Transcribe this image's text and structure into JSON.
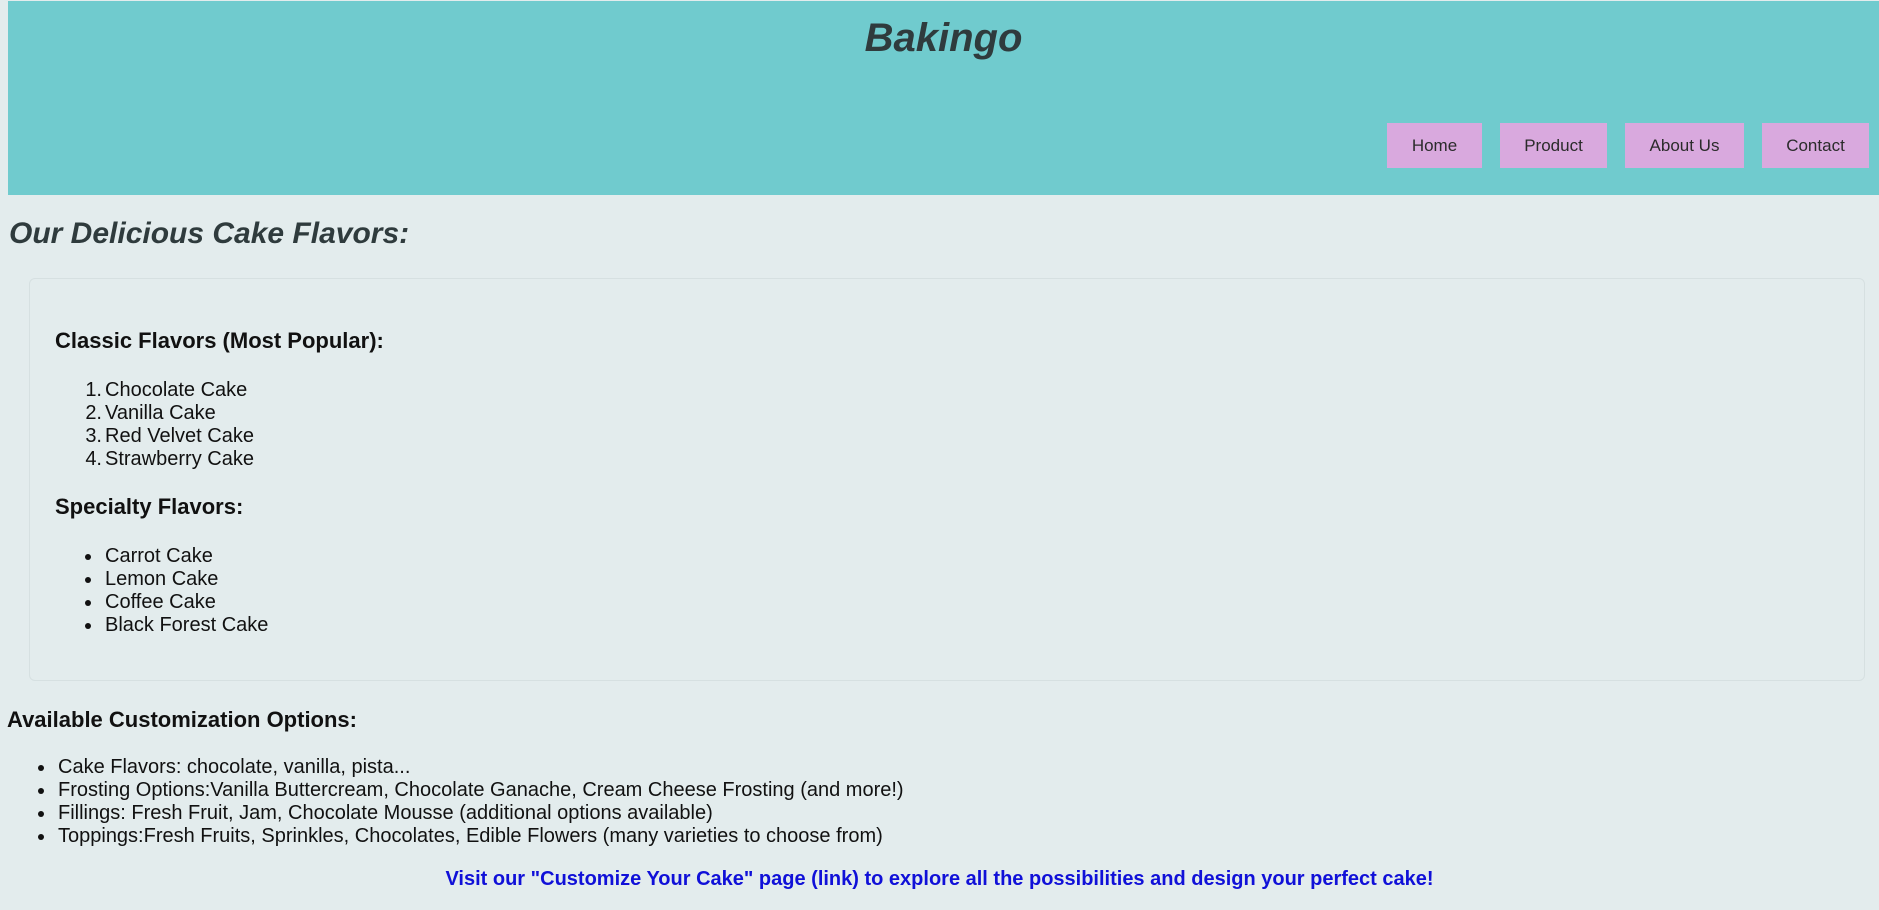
{
  "header": {
    "title": "Bakingo",
    "nav": [
      "Home",
      "Product",
      "About Us",
      "Contact"
    ]
  },
  "flavors": {
    "title": "Our Delicious Cake Flavors:",
    "classic_heading": "Classic Flavors (Most Popular):",
    "classic_items": [
      "Chocolate Cake",
      "Vanilla Cake",
      "Red Velvet Cake",
      "Strawberry Cake"
    ],
    "specialty_heading": "Specialty Flavors:",
    "specialty_items": [
      "Carrot Cake",
      "Lemon Cake",
      "Coffee Cake",
      "Black Forest Cake"
    ]
  },
  "customization": {
    "title": "Available Customization Options:",
    "items": [
      "Cake Flavors: chocolate, vanilla, pista...",
      "Frosting Options:Vanilla Buttercream, Chocolate Ganache, Cream Cheese Frosting (and more!)",
      "Fillings: Fresh Fruit, Jam, Chocolate Mousse (additional options available)",
      "Toppings:Fresh Fruits, Sprinkles, Chocolates, Edible Flowers (many varieties to choose from)"
    ],
    "cta": "Visit our \"Customize Your Cake\" page (link) to explore all the possibilities and design your perfect cake!"
  },
  "colors": {
    "header_bg": "#70cbce",
    "page_bg": "#e3eced",
    "nav_button_bg": "#d9a9de",
    "link": "#1010d8"
  }
}
